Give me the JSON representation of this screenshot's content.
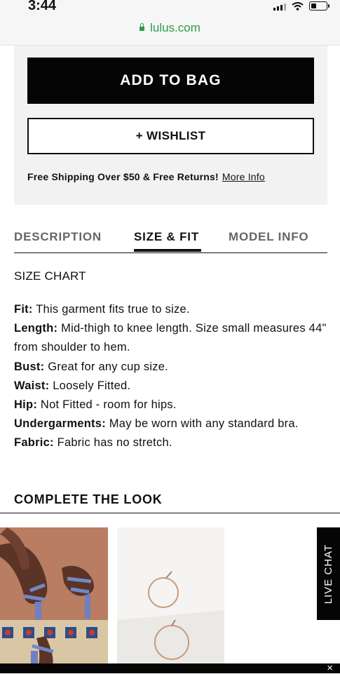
{
  "status_bar": {
    "time": "3:44"
  },
  "browser": {
    "url": "lulus.com"
  },
  "purchase": {
    "add_to_bag": "ADD TO BAG",
    "wishlist": "+ WISHLIST",
    "shipping_text": "Free Shipping Over $50 & Free Returns!",
    "more_info": "More Info"
  },
  "tabs": [
    {
      "label": "DESCRIPTION",
      "active": false
    },
    {
      "label": "SIZE & FIT",
      "active": true
    },
    {
      "label": "MODEL INFO",
      "active": false
    }
  ],
  "size_fit": {
    "size_chart": "SIZE CHART",
    "details": [
      {
        "label": "Fit:",
        "text": "This garment fits true to size."
      },
      {
        "label": "Length:",
        "text": "Mid-thigh to knee length. Size small measures 44\" from shoulder to hem."
      },
      {
        "label": "Bust:",
        "text": "Great for any cup size."
      },
      {
        "label": "Waist:",
        "text": "Loosely Fitted."
      },
      {
        "label": "Hip:",
        "text": "Not Fitted - room for hips."
      },
      {
        "label": "Undergarments:",
        "text": "May be worn with any standard bra."
      },
      {
        "label": "Fabric:",
        "text": "Fabric has no stretch."
      }
    ]
  },
  "complete_look": {
    "title": "COMPLETE THE LOOK",
    "items": [
      {
        "image": "blue strappy heeled sandals on tiled steps"
      },
      {
        "image": "gold hoop earrings on white background"
      }
    ]
  },
  "live_chat": "LIVE CHAT",
  "close": "×"
}
